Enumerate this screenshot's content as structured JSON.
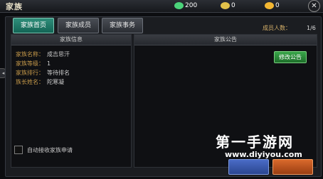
{
  "header": {
    "title": "家族",
    "resources": [
      {
        "name": "green-gem-icon",
        "value": "200",
        "color": "#4bd37a"
      },
      {
        "name": "gold-coin-icon",
        "value": "0",
        "color": "#e2c24a"
      },
      {
        "name": "yellow-gem-icon",
        "value": "0",
        "color": "#f2b632"
      }
    ],
    "close_label": "✕"
  },
  "tabs": [
    {
      "label": "家族首页",
      "active": true
    },
    {
      "label": "家族成员",
      "active": false
    },
    {
      "label": "家族事务",
      "active": false
    }
  ],
  "members": {
    "label": "成员人数：",
    "value": "1/6"
  },
  "info": {
    "heading": "家族信息",
    "rows": [
      {
        "label": "家族名称：",
        "value": "成吉思汗"
      },
      {
        "label": "家族等级：",
        "value": "1"
      },
      {
        "label": "家族排行：",
        "value": "等待排名"
      },
      {
        "label": "族长姓名：",
        "value": "陀寒凝"
      }
    ]
  },
  "notice": {
    "heading": "家族公告",
    "button": "修改公告"
  },
  "auto_accept": {
    "label": "自动接收家族申请"
  },
  "bottom_buttons": [
    {
      "label": "",
      "color": "#3a58b0"
    },
    {
      "label": "",
      "color": "#c0521e"
    }
  ],
  "watermark": {
    "text": "第一手游网",
    "url": "www.diyiyou.com"
  }
}
